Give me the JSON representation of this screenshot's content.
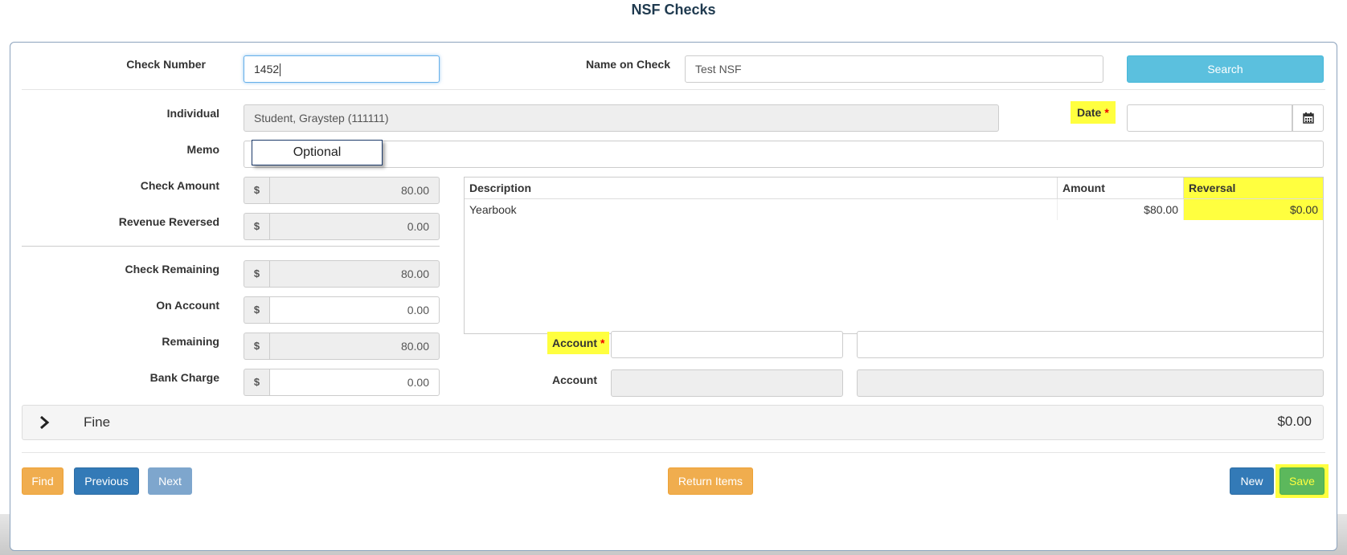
{
  "title": "NSF Checks",
  "fields": {
    "check_number_label": "Check Number",
    "check_number_value": "1452",
    "name_on_check_label": "Name on Check",
    "name_on_check_value": "Test NSF",
    "search_label": "Search",
    "individual_label": "Individual",
    "individual_value": "Student, Graystep (111111)",
    "date_label": "Date",
    "date_value": "",
    "memo_label": "Memo",
    "memo_popup": "Optional",
    "required_mark": "*"
  },
  "amounts": {
    "currency_symbol": "$",
    "check_amount_label": "Check Amount",
    "check_amount_value": "80.00",
    "revenue_reversed_label": "Revenue Reversed",
    "revenue_reversed_value": "0.00",
    "check_remaining_label": "Check Remaining",
    "check_remaining_value": "80.00",
    "on_account_label": "On Account",
    "on_account_value": "0.00",
    "remaining_label": "Remaining",
    "remaining_value": "80.00",
    "bank_charge_label": "Bank Charge",
    "bank_charge_value": "0.00"
  },
  "grid": {
    "columns": [
      "Description",
      "Amount",
      "Reversal"
    ],
    "rows": [
      {
        "description": "Yearbook",
        "amount": "$80.00",
        "reversal": "$0.00"
      }
    ]
  },
  "accounts": {
    "account_label_required": "Account",
    "account_label": "Account"
  },
  "fine": {
    "label": "Fine",
    "amount": "$0.00"
  },
  "buttons": {
    "find": "Find",
    "previous": "Previous",
    "next": "Next",
    "return_items": "Return Items",
    "new": "New",
    "save": "Save"
  },
  "colors": {
    "highlight": "#ffff3f",
    "primary": "#337ab7",
    "warning": "#f0ad4e",
    "info": "#5bc0de",
    "success": "#5cb85c",
    "title": "#1f3a4f"
  },
  "icons": {
    "calendar": "calendar-icon",
    "expand": "chevron-right-icon"
  }
}
